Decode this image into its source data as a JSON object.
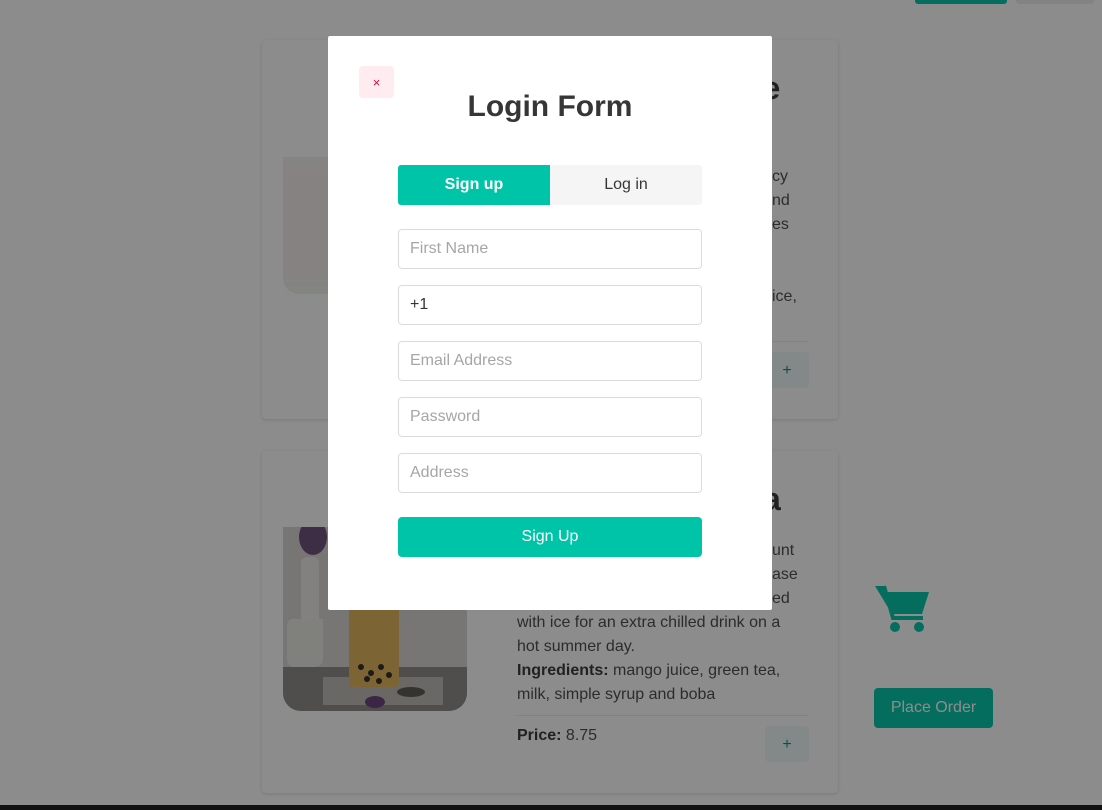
{
  "cards": [
    {
      "title": "ple",
      "description_lines": [
        "cy",
        "nd",
        "es"
      ],
      "ingredients_tail": "ice,",
      "add_label": "+"
    },
    {
      "title": "a",
      "description_lines": [
        "unt",
        "ase",
        "ed",
        "with ice for an extra chilled drink on a",
        "hot summer day."
      ],
      "ingredients_label": "Ingredients:",
      "ingredients_value": " mango juice, green tea,",
      "ingredients_line2": "milk, simple syrup and boba",
      "price_label": "Price:",
      "price_value": " 8.75",
      "add_label": "+"
    }
  ],
  "cart_icon": "shopping-cart-icon",
  "place_order_label": "Place Order",
  "modal": {
    "close_label": "×",
    "title": "Login Form",
    "tabs": [
      {
        "label": "Sign up",
        "active": true
      },
      {
        "label": "Log in",
        "active": false
      }
    ],
    "first_name_placeholder": "First Name",
    "phone_value": "+1",
    "email_placeholder": "Email Address",
    "password_placeholder": "Password",
    "address_placeholder": "Address",
    "submit_label": "Sign Up"
  },
  "colors": {
    "accent": "#00c4a7",
    "cart": "#3ba5a8",
    "close_bg": "#feecf0",
    "close_fg": "#cc0f35"
  }
}
